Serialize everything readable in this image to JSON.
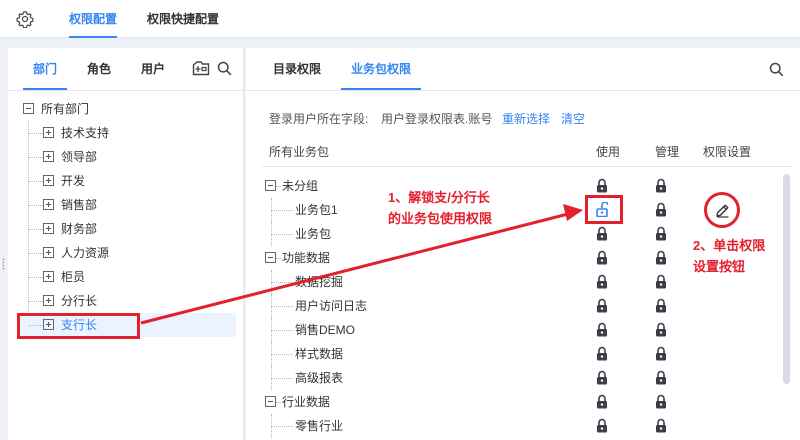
{
  "top_tabs": [
    "权限配置",
    "权限快捷配置"
  ],
  "left_tabs": [
    "部门",
    "角色",
    "用户"
  ],
  "dept_tree": {
    "root": "所有部门",
    "children": [
      "技术支持",
      "领导部",
      "开发",
      "销售部",
      "财务部",
      "人力资源",
      "柜员",
      "分行长",
      "支行长"
    ]
  },
  "right_tabs": [
    "目录权限",
    "业务包权限"
  ],
  "login_field": {
    "label": "登录用户所在字段:",
    "value": "用户登录权限表.账号",
    "reselect": "重新选择",
    "clear": "清空"
  },
  "table_headers": {
    "packages": "所有业务包",
    "use": "使用",
    "manage": "管理",
    "settings": "权限设置"
  },
  "package_rows": [
    {
      "label": "未分组",
      "group": true
    },
    {
      "label": "业务包1",
      "group": false
    },
    {
      "label": "业务包",
      "group": false
    },
    {
      "label": "功能数据",
      "group": true
    },
    {
      "label": "数据挖掘",
      "group": false
    },
    {
      "label": "用户访问日志",
      "group": false
    },
    {
      "label": "销售DEMO",
      "group": false
    },
    {
      "label": "样式数据",
      "group": false
    },
    {
      "label": "高级报表",
      "group": false
    },
    {
      "label": "行业数据",
      "group": true
    },
    {
      "label": "零售行业",
      "group": false
    }
  ],
  "annotations": {
    "step1_line1": "1、解锁支/分行长",
    "step1_line2": "的业务包使用权限",
    "step2_line1": "2、单击权限",
    "step2_line2": "设置按钮"
  },
  "colors": {
    "accent": "#3685f2",
    "annotation_red": "#e5202e"
  },
  "icons": {
    "settings": "gear-icon",
    "add_folder": "folder-plus-icon",
    "search": "search-icon",
    "locked": "lock-icon",
    "unlocked": "unlock-icon",
    "edit": "pencil-icon"
  }
}
